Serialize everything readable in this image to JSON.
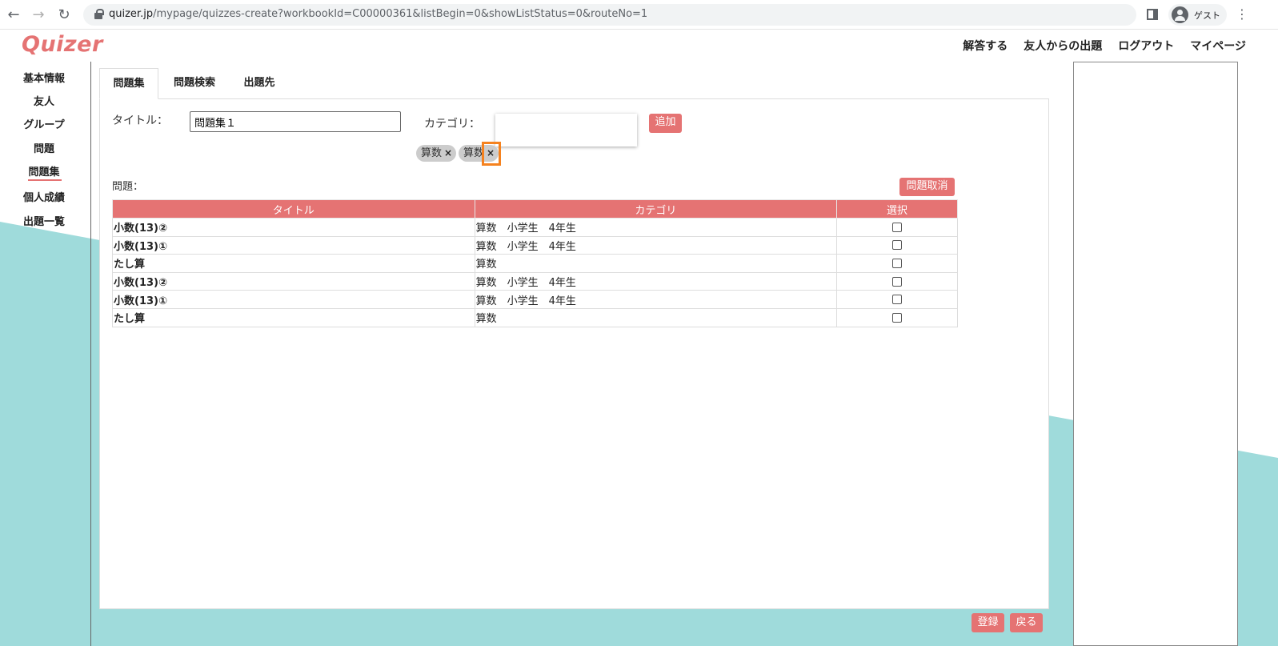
{
  "browser": {
    "url_host": "quizer.jp",
    "url_path": "/mypage/quizzes-create?workbookId=C00000361&listBegin=0&showListStatus=0&routeNo=1",
    "profile_label": "ゲスト"
  },
  "site": {
    "logo": "Quizer",
    "nav": [
      "解答する",
      "友人からの出題",
      "ログアウト",
      "マイページ"
    ]
  },
  "sidebar": {
    "items": [
      "基本情報",
      "友人",
      "グループ",
      "問題",
      "問題集",
      "個人成績",
      "出題一覧"
    ],
    "active": "問題集"
  },
  "tabs": [
    "問題集",
    "問題検索",
    "出題先"
  ],
  "form": {
    "title_label": "タイトル：",
    "title_value": "問題集１",
    "category_label": "カテゴリ：",
    "add_button": "追加",
    "chips": [
      "算数",
      "算数"
    ],
    "chip_remove": "×",
    "questions_label": "問題：",
    "cancel_button": "問題取消"
  },
  "table": {
    "headers": [
      "タイトル",
      "カテゴリ",
      "選択"
    ],
    "rows": [
      {
        "title": "小数(13)②",
        "category": "算数　小学生　4年生"
      },
      {
        "title": "小数(13)①",
        "category": "算数　小学生　4年生"
      },
      {
        "title": "たし算",
        "category": "算数"
      },
      {
        "title": "小数(13)②",
        "category": "算数　小学生　4年生"
      },
      {
        "title": "小数(13)①",
        "category": "算数　小学生　4年生"
      },
      {
        "title": "たし算",
        "category": "算数"
      }
    ]
  },
  "footer": {
    "register_button": "登録",
    "back_button": "戻る"
  },
  "colors": {
    "accent": "#e57373",
    "background_shape": "#9fdbdb",
    "highlight": "#f5821f"
  }
}
